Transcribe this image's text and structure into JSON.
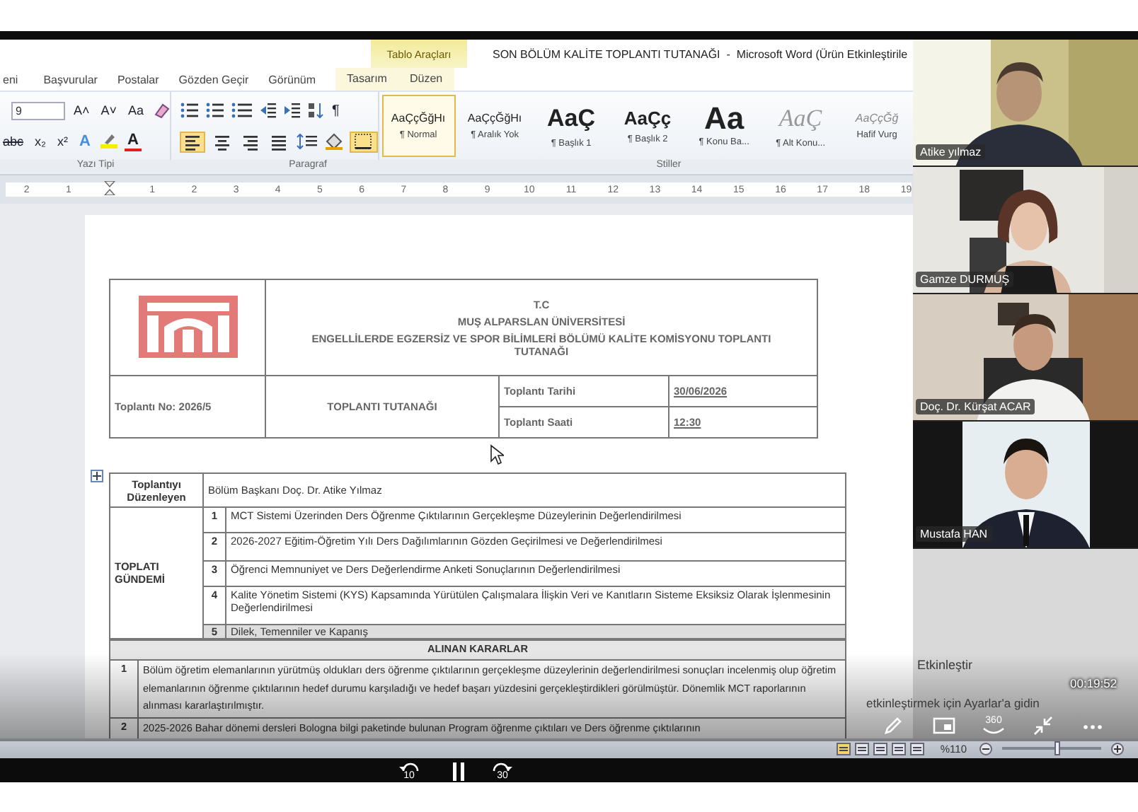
{
  "word": {
    "contextual_tab": "Tablo Araçları",
    "title": "SON BÖLÜM KALİTE TOPLANTI TUTANAĞI  -  Microsoft Word (Ürün Etkinleştirile",
    "tabs": [
      {
        "label": "eni",
        "selected": false
      },
      {
        "label": "Başvurular",
        "selected": false
      },
      {
        "label": "Postalar",
        "selected": false
      },
      {
        "label": "Gözden Geçir",
        "selected": false
      },
      {
        "label": "Görünüm",
        "selected": false
      },
      {
        "label": "Tasarım",
        "selected": false
      },
      {
        "label": "Düzen",
        "selected": false
      }
    ],
    "font_size": "9",
    "font_buttons": [
      "A˄",
      "A˅",
      "Aa"
    ],
    "pilcrow": "¶",
    "format_buttons": [
      {
        "label": "abc",
        "kind": "strike"
      },
      {
        "label": "x₂",
        "kind": "plain"
      },
      {
        "label": "x²",
        "kind": "plain"
      },
      {
        "label": "A",
        "kind": "effect"
      },
      {
        "label": "A",
        "kind": "color"
      }
    ],
    "alignment": [
      {
        "kind": "left",
        "selected": true
      },
      {
        "kind": "center",
        "selected": false
      },
      {
        "kind": "right",
        "selected": false
      },
      {
        "kind": "justify",
        "selected": false
      }
    ],
    "styles": [
      {
        "sample": "AaÇçĞğHı",
        "name": "¶ Normal",
        "kind": "body",
        "selected": true
      },
      {
        "sample": "AaÇçĞğHı",
        "name": "¶ Aralık Yok",
        "kind": "body",
        "selected": false
      },
      {
        "sample": "AaÇ",
        "name": "¶ Başlık 1",
        "kind": "heading",
        "selected": false
      },
      {
        "sample": "AaÇç",
        "name": "¶ Başlık 2",
        "kind": "heading2",
        "selected": false
      },
      {
        "sample": "Aa",
        "name": "¶ Konu Ba...",
        "kind": "title",
        "selected": false
      },
      {
        "sample": "AaÇ",
        "name": "¶ Alt Konu...",
        "kind": "subtitle",
        "selected": false
      },
      {
        "sample": "AaÇçĞğ",
        "name": "Hafif Vurg",
        "kind": "emphasis",
        "selected": false
      }
    ],
    "group_labels": [
      "Yazı Tipi",
      "Paragraf",
      "Stiller"
    ],
    "ruler": [
      "2",
      "1",
      "1",
      "2",
      "3",
      "4",
      "5",
      "6",
      "7",
      "8",
      "9",
      "10",
      "11",
      "12",
      "13",
      "14",
      "15",
      "16",
      "17",
      "18",
      "19"
    ],
    "header": {
      "line1": "T.C",
      "line2": "MUŞ ALPARSLAN ÜNİVERSİTESİ",
      "line3": "ENGELLİLERDE EGZERSİZ VE SPOR BİLİMLERİ BÖLÜMÜ KALİTE KOMİSYONU TOPLANTI TUTANAĞI",
      "number": "Toplantı No: 2026/5",
      "doc_type": "TOPLANTI TUTANAĞI",
      "date_label": "Toplantı Tarihi",
      "date": "30/06/2026",
      "time_label": "Toplantı Saati",
      "time": "12:30"
    },
    "agenda": {
      "organizer_label": "Toplantıyı Düzenleyen",
      "organizer": "Bölüm Başkanı Doç. Dr. Atike Yılmaz",
      "label": "TOPLATI GÜNDEMİ",
      "items": [
        {
          "number": "1",
          "text": "MCT Sistemi Üzerinden Ders Öğrenme Çıktılarının Gerçekleşme Düzeylerinin Değerlendirilmesi"
        },
        {
          "number": "2",
          "text": "2026-2027 Eğitim-Öğretim Yılı Ders Dağılımlarının Gözden Geçirilmesi ve Değerlendirilmesi"
        },
        {
          "number": "3",
          "text": "Öğrenci Memnuniyet ve Ders Değerlendirme Anketi Sonuçlarının Değerlendirilmesi"
        },
        {
          "number": "4",
          "text": "Kalite Yönetim Sistemi (KYS) Kapsamında Yürütülen Çalışmalara İlişkin Veri ve Kanıtların Sisteme Eksiksiz Olarak İşlenmesinin Değerlendirilmesi"
        },
        {
          "number": "5",
          "text": "Dilek, Temenniler ve Kapanış"
        }
      ]
    },
    "decisions": {
      "title": "ALINAN KARARLAR",
      "items": [
        {
          "number": "1",
          "text": "Bölüm öğretim elemanlarının yürütmüş oldukları ders öğrenme çıktılarının gerçekleşme düzeylerinin değerlendirilmesi sonuçları incelenmiş olup öğretim elemanlarının öğrenme çıktılarının hedef durumu karşıladığı ve hedef başarı yüzdesini gerçekleştirdikleri görülmüştür. Dönemlik MCT raporlarının alınması kararlaştırılmıştır."
        },
        {
          "number": "2",
          "text": "2025-2026 Bahar dönemi dersleri Bologna bilgi paketinde bulunan Program öğrenme çıktıları ve Ders öğrenme çıktılarının"
        }
      ]
    },
    "status_zoom": "%110",
    "zoom": {
      "level": 0.55
    }
  },
  "participants": [
    {
      "name": "Atike yılmaz"
    },
    {
      "name": "Gamze DURMUŞ"
    },
    {
      "name": "Doç. Dr. Kürşat ACAR"
    },
    {
      "name": "Mustafa HAN"
    }
  ],
  "player": {
    "watermark": [
      "Etkinleştir",
      "etkinleştirmek için Ayarlar'a gidin"
    ],
    "time": "00:19:52",
    "skip_back": "10",
    "skip_forward": "30",
    "vr_label": "360"
  }
}
